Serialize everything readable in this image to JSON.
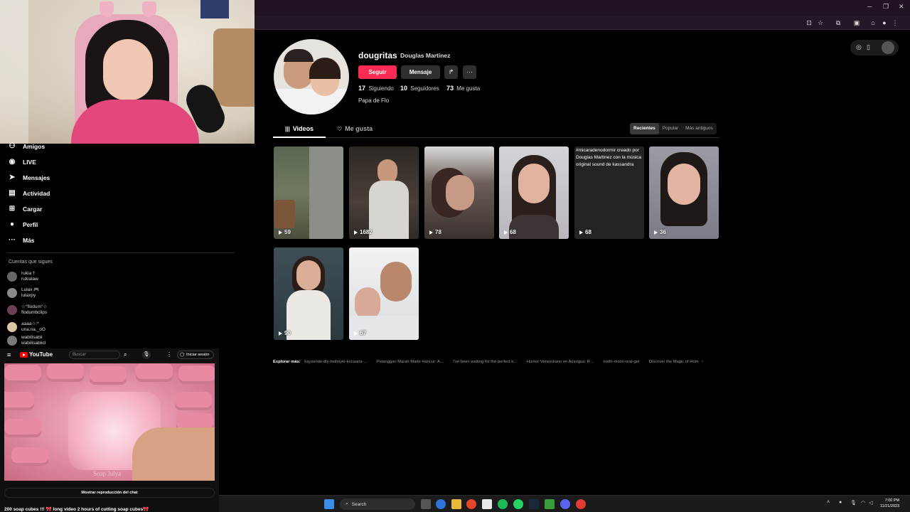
{
  "profile": {
    "username": "dougritas",
    "display_name": "Douglas Martinez",
    "follow_label": "Seguir",
    "message_label": "Mensaje",
    "stats": [
      {
        "value": "17",
        "label": "Siguiendo"
      },
      {
        "value": "10",
        "label": "Seguidores"
      },
      {
        "value": "73",
        "label": "Me gusta"
      }
    ],
    "bio": "Papa de Flo"
  },
  "tabs": {
    "videos_label": "Videos",
    "likes_label": "Me gusta"
  },
  "sort": {
    "recent": "Recientes",
    "popular": "Popular",
    "oldest": "Más antiguos"
  },
  "videos": [
    {
      "views": "59"
    },
    {
      "views": "1682"
    },
    {
      "views": "78"
    },
    {
      "views": "68"
    },
    {
      "views": "68",
      "caption": "#micaradenodormir creado por Douglas Martinez con la música original sound de kassandra"
    },
    {
      "views": "36"
    },
    {
      "views": "90"
    },
    {
      "views": "67"
    }
  ],
  "explore": {
    "label": "Explorar más:",
    "links": [
      "kayseride-diy-helmiyle-kocaana-...",
      "Pelanggan Marah Mado Hancur: A...",
      "I've been waiting for the perfect b...",
      "Humor Venezolano en Acarigua: R...",
      "north-moon-oral-gel",
      "Discover the Magic of Hom"
    ]
  },
  "sidebar": {
    "items": [
      {
        "label": "Amigos",
        "icon": "friends-icon"
      },
      {
        "label": "LIVE",
        "icon": "live-icon"
      },
      {
        "label": "Mensajes",
        "icon": "messages-icon"
      },
      {
        "label": "Actividad",
        "icon": "activity-icon"
      },
      {
        "label": "Cargar",
        "icon": "upload-icon"
      },
      {
        "label": "Perfil",
        "icon": "profile-icon"
      },
      {
        "label": "Más",
        "icon": "more-icon"
      }
    ],
    "following_title": "Cuentas que sigues",
    "accounts": [
      {
        "name": "rukia †",
        "handle": "rukialaw"
      },
      {
        "name": "Lulax 🎮",
        "handle": "lulaxpy"
      },
      {
        "name": "☆°flodum°☆",
        "handle": "flodumbclips"
      },
      {
        "name": "aaaa☆:*",
        "handle": "una.na._oO"
      },
      {
        "name": "wabilisabii",
        "handle": "wabilisabiicl"
      }
    ]
  },
  "youtube": {
    "logo": "YouTube",
    "search_placeholder": "Buscar",
    "login_label": "Iniciar sesión",
    "watermark": "Soap Julya",
    "chat_label": "Mostrar reproducción del chat",
    "video_title": "200 soap cubes !!! 🎀 long video 2 hours of cutting soap cubes🎀"
  },
  "taskbar": {
    "search_label": "Search",
    "time": "7:00 PM",
    "date": "11/21/2023"
  },
  "colors": {
    "accent": "#fe2c55",
    "background": "#000000",
    "chrome": "#231827"
  }
}
